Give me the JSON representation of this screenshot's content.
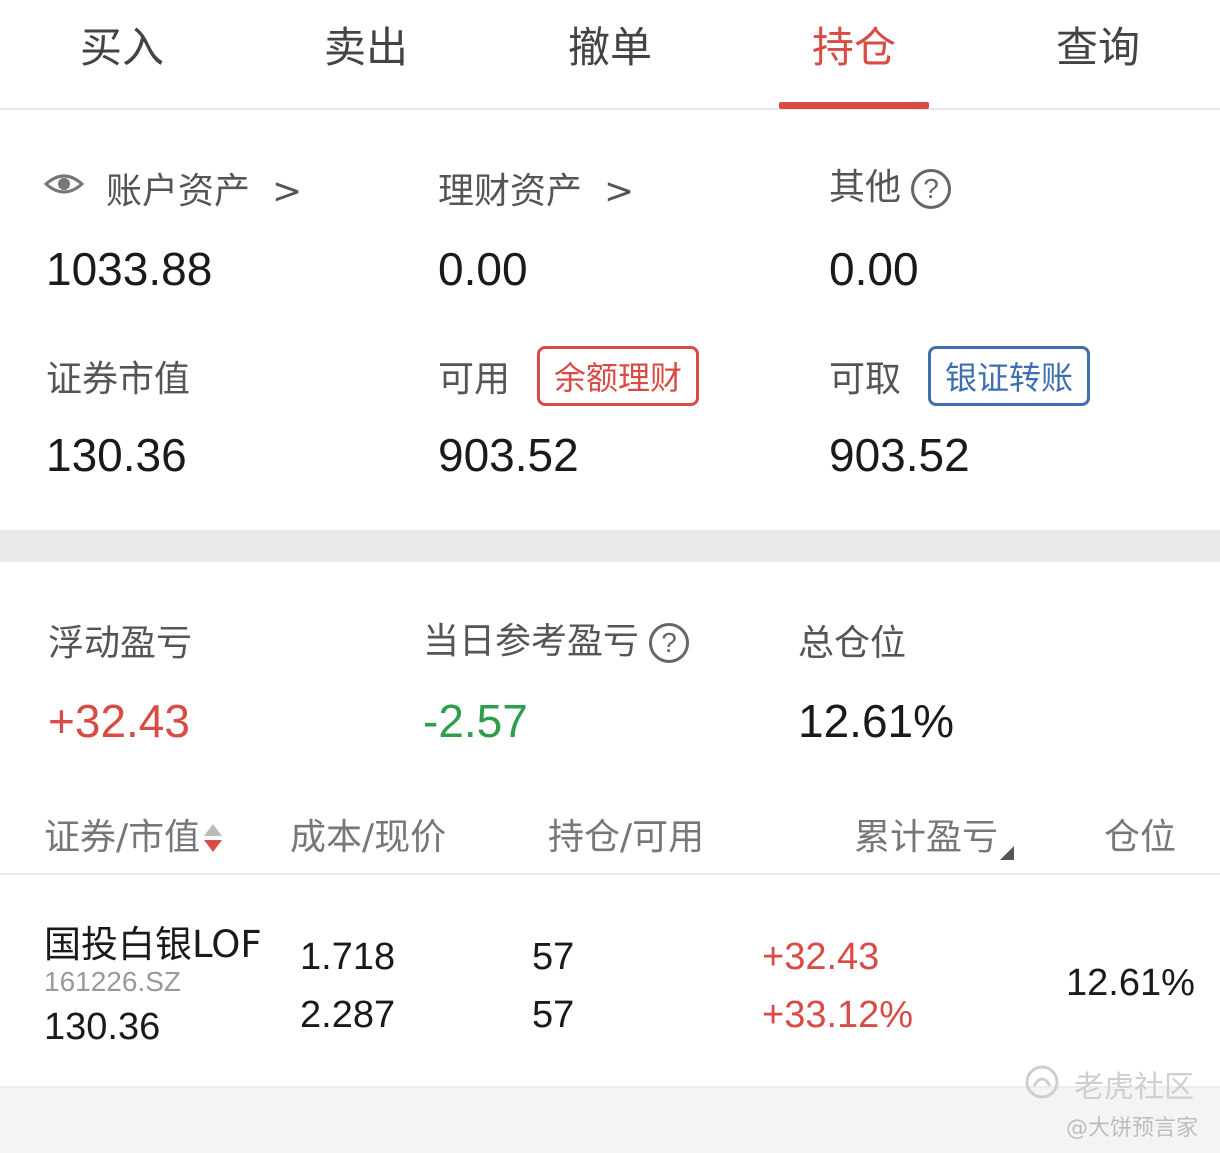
{
  "tabs": [
    {
      "label": "买入"
    },
    {
      "label": "卖出"
    },
    {
      "label": "撤单"
    },
    {
      "label": "持仓",
      "active": true
    },
    {
      "label": "查询"
    }
  ],
  "assets": {
    "account_label": "账户资产",
    "account_value": "1033.88",
    "wealth_label": "理财资产",
    "wealth_value": "0.00",
    "other_label": "其他",
    "other_value": "0.00",
    "securities_label": "证券市值",
    "securities_value": "130.36",
    "available_label": "可用",
    "available_tag": "余额理财",
    "available_value": "903.52",
    "withdrawable_label": "可取",
    "withdrawable_tag": "银证转账",
    "withdrawable_value": "903.52",
    "chevron": ">",
    "help_glyph": "?"
  },
  "summary": {
    "floating_pl_label": "浮动盈亏",
    "floating_pl_value": "+32.43",
    "daily_pl_label": "当日参考盈亏",
    "daily_pl_value": "-2.57",
    "total_position_label": "总仓位",
    "total_position_value": "12.61%"
  },
  "table": {
    "headers": {
      "security": "证券/市值",
      "cost": "成本/现价",
      "holding": "持仓/可用",
      "cumulative": "累计盈亏",
      "position": "仓位"
    },
    "rows": [
      {
        "name": "国投白银LOF",
        "code": "161226.SZ",
        "market_value": "130.36",
        "cost": "1.718",
        "price": "2.287",
        "holding": "57",
        "available": "57",
        "pl_amount": "+32.43",
        "pl_percent": "+33.12%",
        "position": "12.61%"
      }
    ]
  },
  "watermark": {
    "brand": "老虎社区",
    "author": "@大饼预言家"
  },
  "colors": {
    "accent_red": "#d94b45",
    "green": "#2f9e4a",
    "blue_tag": "#3f6fb0"
  }
}
